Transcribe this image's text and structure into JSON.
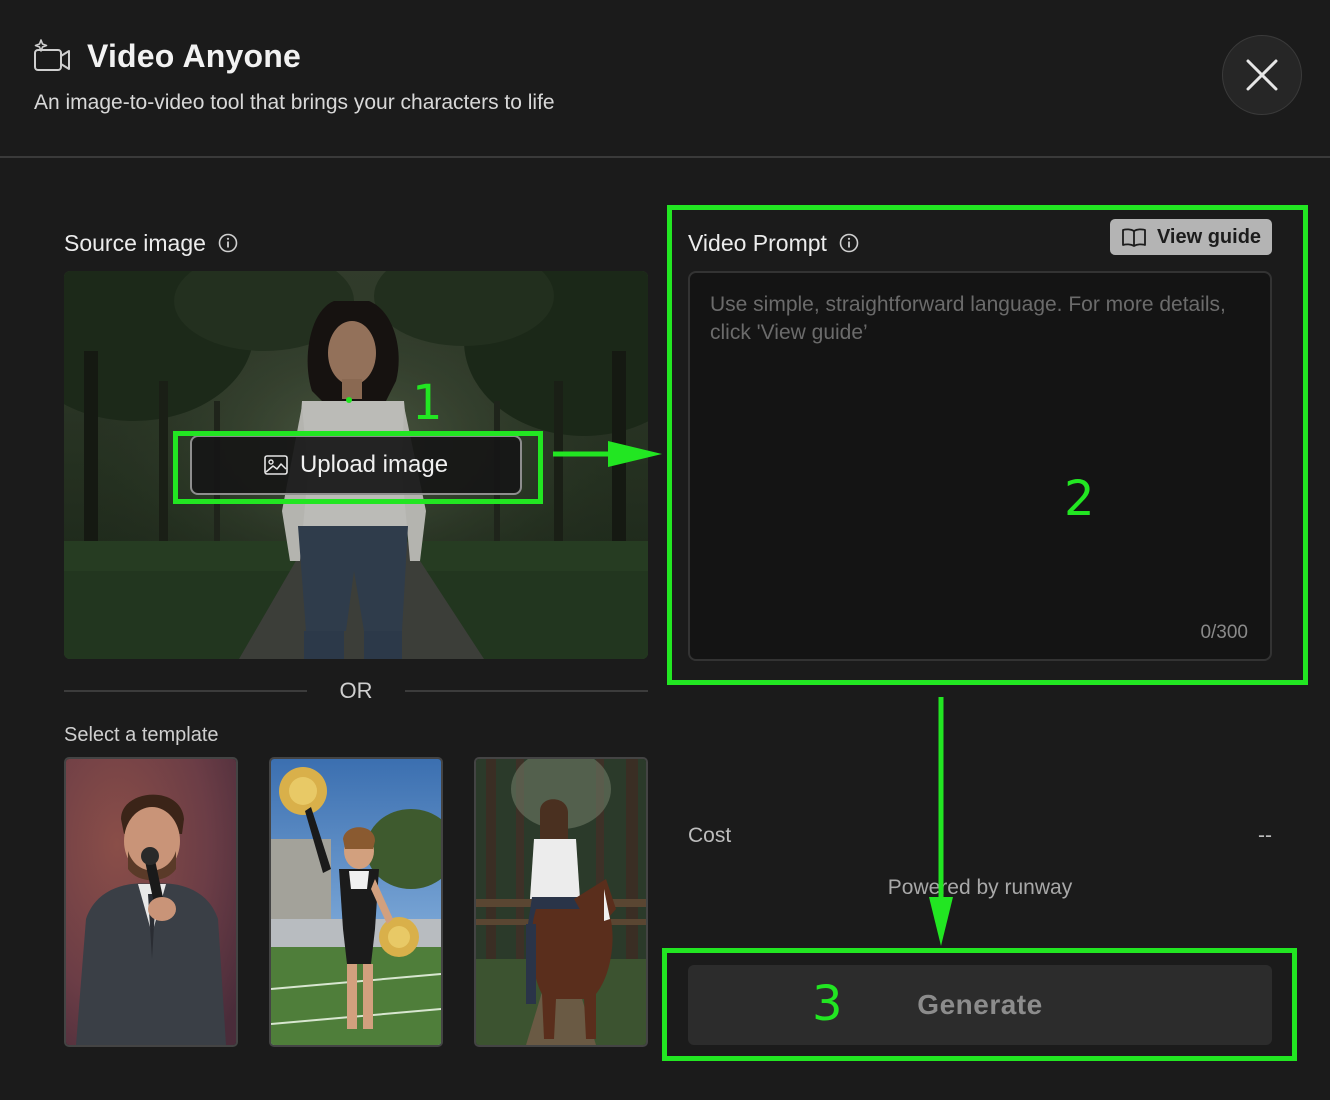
{
  "header": {
    "title": "Video Anyone",
    "subtitle": "An image-to-video tool that brings your characters to life",
    "icon": "video-camera-sparkle-icon",
    "close_icon": "close-icon"
  },
  "source": {
    "label": "Source image",
    "upload_label": "Upload image",
    "or_text": "OR",
    "template_label": "Select a template",
    "templates": [
      {
        "name": "man-speaking-into-microphone"
      },
      {
        "name": "cheerleader-with-pom-poms"
      },
      {
        "name": "woman-riding-horse"
      }
    ]
  },
  "prompt": {
    "label": "Video Prompt",
    "view_guide_label": "View guide",
    "placeholder": "Use simple, straightforward language. For more details, click 'View guide’",
    "char_count": "0/300"
  },
  "footer": {
    "cost_label": "Cost",
    "cost_value": "--",
    "powered_by": "Powered by runway",
    "generate_label": "Generate"
  },
  "annotations": {
    "step1": "1",
    "step2": "2",
    "step3": "3",
    "color": "#22e622"
  },
  "colors": {
    "background": "#1b1b1b",
    "accent": "#22e622",
    "button_disabled": "#2c2c2c"
  }
}
